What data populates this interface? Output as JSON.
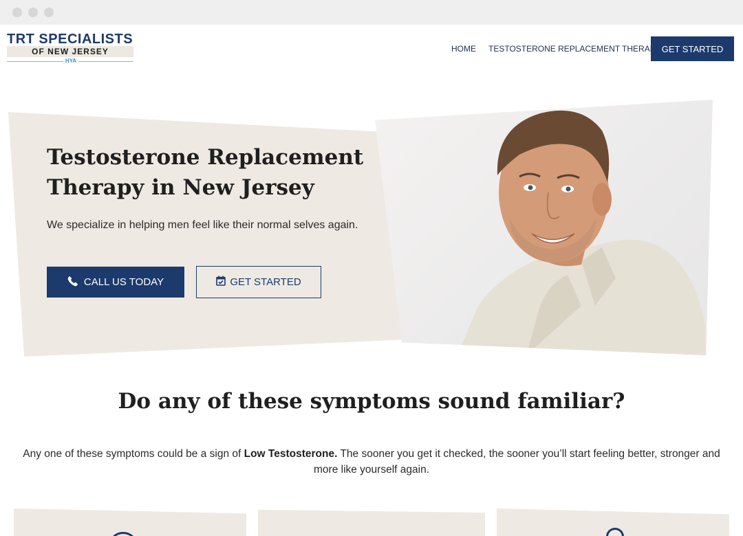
{
  "window": {
    "controls": [
      "close-dot",
      "minimize-dot",
      "maximize-dot"
    ]
  },
  "header": {
    "logo": {
      "line1": "TRT SPECIALISTS",
      "line2": "OF NEW JERSEY",
      "mark": "HYA"
    },
    "nav": {
      "home": "HOME",
      "trt": "TESTOSTERONE REPLACEMENT THERAPY"
    },
    "cta": "GET STARTED"
  },
  "hero": {
    "title_line1": "Testosterone Replacement",
    "title_line2": "Therapy in New Jersey",
    "subtitle": "We specialize in helping men feel like their normal selves again.",
    "call_button": "CALL US TODAY",
    "start_button": "GET STARTED",
    "photo_alt": "smiling middle-aged man in light shirt"
  },
  "symptoms": {
    "title": "Do any of these symptoms sound familiar?",
    "text_before": "Any one of these symptoms could be a sign of ",
    "text_bold": "Low Testosterone.",
    "text_after": "  The sooner you get it checked, the sooner you’ll start feeling better, stronger and more like yourself again."
  },
  "colors": {
    "navy": "#1c3a6b",
    "beige": "#eeeae3",
    "text": "#1f1f1f"
  },
  "icons": [
    "phone-icon",
    "calendar-check-icon"
  ]
}
